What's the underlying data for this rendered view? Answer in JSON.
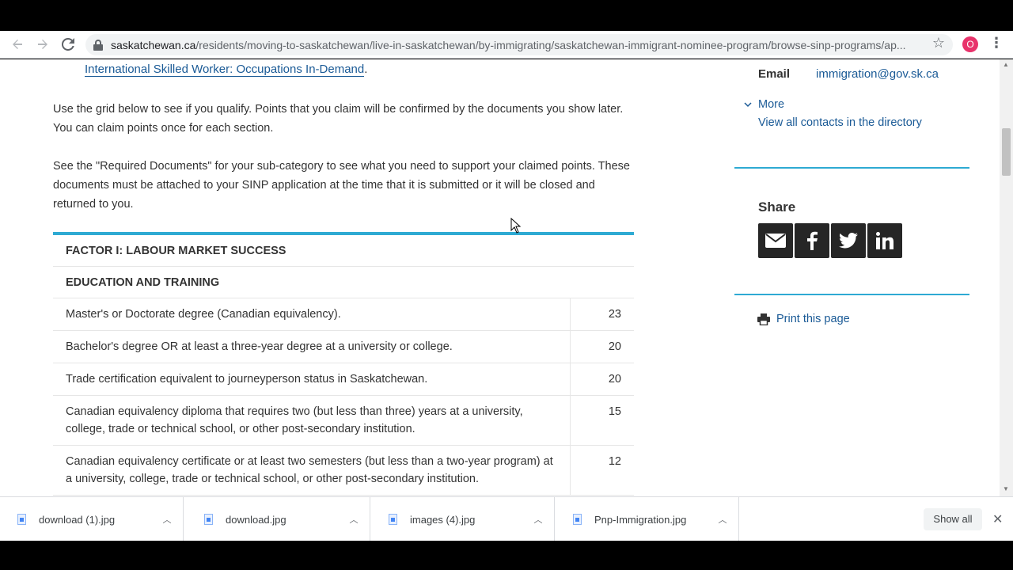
{
  "browser": {
    "url_domain": "saskatchewan.ca",
    "url_path": "/residents/moving-to-saskatchewan/live-in-saskatchewan/by-immigrating/saskatchewan-immigrant-nominee-program/browse-sinp-programs/ap...",
    "profile_initial": "O"
  },
  "page": {
    "top_link": "International Skilled Worker: Occupations In-Demand",
    "top_link_suffix": ".",
    "para1": "Use the grid below to see if you qualify. Points that you claim will be confirmed by the documents you show later. You can claim points once for each section.",
    "para2": "See the \"Required Documents\" for your sub-category to see what you need to support your claimed points. These documents must be attached to your SINP application at the time that it is submitted or it will be closed and returned to you.",
    "table": {
      "factor_heading": "FACTOR I: LABOUR MARKET SUCCESS",
      "section_heading": "EDUCATION AND TRAINING",
      "rows": [
        {
          "desc": "Master's or Doctorate degree (Canadian equivalency).",
          "points": "23"
        },
        {
          "desc": "Bachelor's degree OR at least a three-year degree at a university or college.",
          "points": "20"
        },
        {
          "desc": "Trade certification equivalent to journeyperson status in Saskatchewan.",
          "points": "20"
        },
        {
          "desc": "Canadian equivalency diploma that requires two (but less than three) years at a university, college, trade or technical school, or other post-secondary institution.",
          "points": "15"
        },
        {
          "desc": "Canadian equivalency certificate or at least two semesters (but less than a two-year program) at a university, college, trade or technical school, or other post-secondary institution.",
          "points": "12"
        }
      ]
    }
  },
  "sidebar": {
    "email_label": "Email",
    "email_value": "immigration@gov.sk.ca",
    "more_label": "More",
    "directory_link": "View all contacts in the directory",
    "share_title": "Share",
    "share_buttons": [
      "email",
      "facebook",
      "twitter",
      "linkedin"
    ],
    "print_label": "Print this page"
  },
  "downloads": {
    "items": [
      "download (1).jpg",
      "download.jpg",
      "images (4).jpg",
      "Pnp-Immigration.jpg"
    ],
    "show_all": "Show all"
  },
  "colors": {
    "accent": "#2eaad3",
    "link": "#1a5a96",
    "share_bg": "#262626"
  }
}
